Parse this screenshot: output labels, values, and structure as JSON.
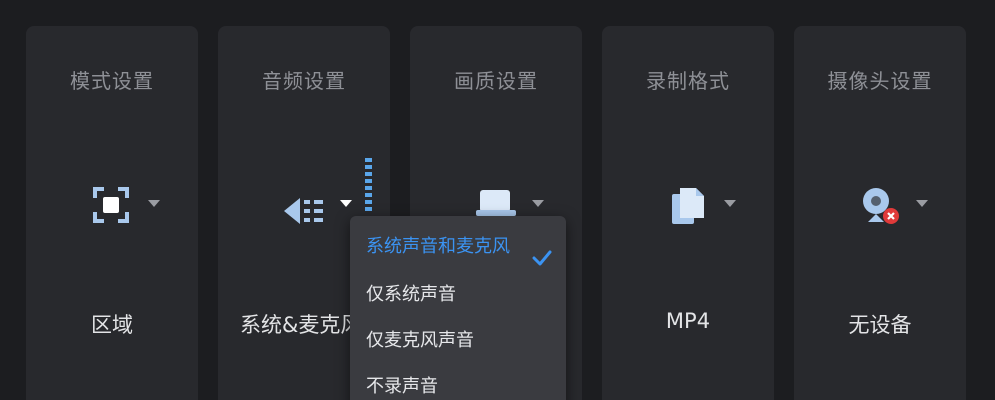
{
  "panels": [
    {
      "title": "模式设置",
      "value": "区域",
      "icon": "region-capture-icon"
    },
    {
      "title": "音频设置",
      "value": "系统&麦克风",
      "icon": "speaker-icon"
    },
    {
      "title": "画质设置",
      "value": "",
      "icon": "display-quality-icon"
    },
    {
      "title": "录制格式",
      "value": "MP4",
      "icon": "file-format-icon"
    },
    {
      "title": "摄像头设置",
      "value": "无设备",
      "icon": "webcam-disabled-icon"
    }
  ],
  "audio_dropdown": {
    "items": [
      {
        "label": "系统声音和麦克风",
        "selected": true
      },
      {
        "label": "仅系统声音",
        "selected": false
      },
      {
        "label": "仅麦克风声音",
        "selected": false
      },
      {
        "label": "不录声音",
        "selected": false
      }
    ]
  },
  "colors": {
    "background": "#1c1d20",
    "panel": "#28292d",
    "dropdown": "#3a3b40",
    "accent": "#3b93f2",
    "icon_blue": "#a9c8ec"
  }
}
